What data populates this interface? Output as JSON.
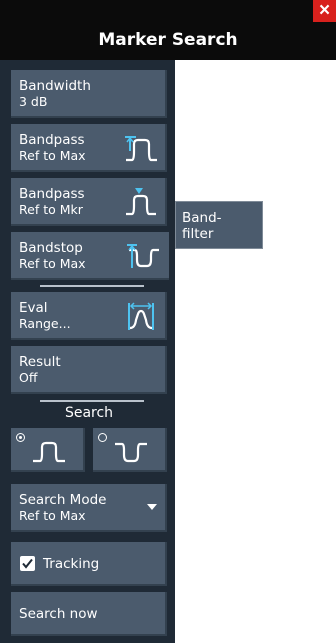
{
  "header": {
    "title": "Marker Search",
    "close_label": "×"
  },
  "buttons": {
    "bandwidth": {
      "line1": "Bandwidth",
      "line2": "3 dB"
    },
    "bandpass_ref_max": {
      "line1": "Bandpass",
      "line2": "Ref to Max",
      "icon": "bandpass-ref-max-icon"
    },
    "bandpass_ref_mkr": {
      "line1": "Bandpass",
      "line2": "Ref to Mkr",
      "icon": "bandpass-ref-mkr-icon"
    },
    "bandstop_ref_max": {
      "line1": "Bandstop",
      "line2": "Ref to Max",
      "icon": "bandstop-ref-max-icon"
    },
    "eval_range": {
      "line1": "Eval",
      "line2": "Range...",
      "icon": "eval-range-icon"
    },
    "result": {
      "line1": "Result",
      "line2": "Off"
    },
    "search_mode": {
      "line1": "Search Mode",
      "line2": "Ref to Max"
    },
    "tracking": {
      "label": "Tracking",
      "checked": true
    },
    "search_now": {
      "label": "Search now"
    }
  },
  "search_section": {
    "label": "Search",
    "options": [
      {
        "icon": "bandpass-shape-icon",
        "selected": true
      },
      {
        "icon": "bandstop-shape-icon",
        "selected": false
      }
    ]
  },
  "submenu": {
    "line1": "Band-",
    "line2": "filter"
  },
  "colors": {
    "header_bg": "#0b0b0b",
    "panel_bg": "#1f2a36",
    "button_bg": "#4b5b6d",
    "close_bg": "#d8211d"
  }
}
